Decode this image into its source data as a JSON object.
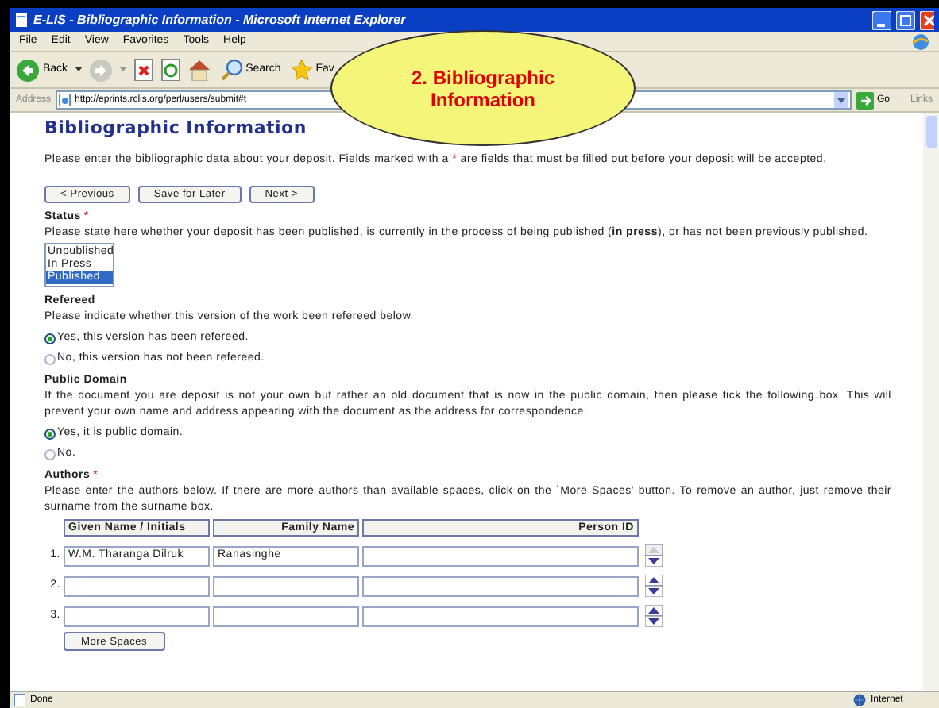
{
  "window": {
    "title": "E-LIS - Bibliographic Information - Microsoft Internet Explorer"
  },
  "menu": [
    "File",
    "Edit",
    "View",
    "Favorites",
    "Tools",
    "Help"
  ],
  "toolbar": {
    "back": "Back",
    "search": "Search",
    "favorites": "Fav"
  },
  "address_bar": {
    "label": "Address",
    "url": "http://eprints.rclis.org/perl/users/submit#t",
    "go": "Go",
    "links": "Links"
  },
  "callout": {
    "text": "2. Bibliographic Information"
  },
  "page": {
    "heading": "Bibliographic Information",
    "intro": [
      {
        "text": "Please enter the bibliographic data about your deposit. Fields marked with a ",
        "kind": "plain"
      },
      {
        "text": "*",
        "kind": "mark"
      },
      {
        "text": " are fields that must be filled out before your deposit will be accepted.",
        "kind": "plain"
      }
    ],
    "nav_buttons": [
      "< Previous",
      "Save for Later",
      "Next >"
    ],
    "status": {
      "title": "Status",
      "required": true,
      "help": "Please state here whether your deposit has been published, is currently in the process of being published (**in press**), or has not been previously published.",
      "options": [
        {
          "label": "Unpublished",
          "selected": false
        },
        {
          "label": "In Press",
          "selected": false
        },
        {
          "label": "Published",
          "selected": true
        }
      ]
    },
    "refereed": {
      "title": "Refereed",
      "required": false,
      "help": "Please indicate whether this version of the work been refereed below.",
      "options": [
        {
          "label": "Yes, this version has been refereed.",
          "selected": true
        },
        {
          "label": "No, this version has not been refereed.",
          "selected": false
        }
      ]
    },
    "public_domain": {
      "title": "Public Domain",
      "required": false,
      "help": "If the document you are deposit is not your own but rather an old document that is now in the public domain, then please tick the following box. This will prevent your own name and address appearing with the document as the address for correspondence.",
      "options": [
        {
          "label": "Yes, it is public domain.",
          "selected": true
        },
        {
          "label": "No.",
          "selected": false
        }
      ]
    },
    "authors": {
      "title": "Authors",
      "required": true,
      "help": "Please enter the authors below. If there are more authors than available spaces, click on the `More Spaces' button. To remove an author, just remove their surname from the surname box.",
      "columns": [
        "Given Name / Initials",
        "Family Name",
        "Person ID"
      ],
      "rows": [
        {
          "number": "1.",
          "given": "W.M. Tharanga Dilruk",
          "family": "Ranasinghe",
          "can_move_up": false
        },
        {
          "number": "2.",
          "can_move_up": true
        },
        {
          "number": "3.",
          "can_move_up": true
        }
      ],
      "more_button": "More Spaces"
    }
  },
  "status_bar": {
    "text": "Done",
    "zone": "Internet"
  }
}
